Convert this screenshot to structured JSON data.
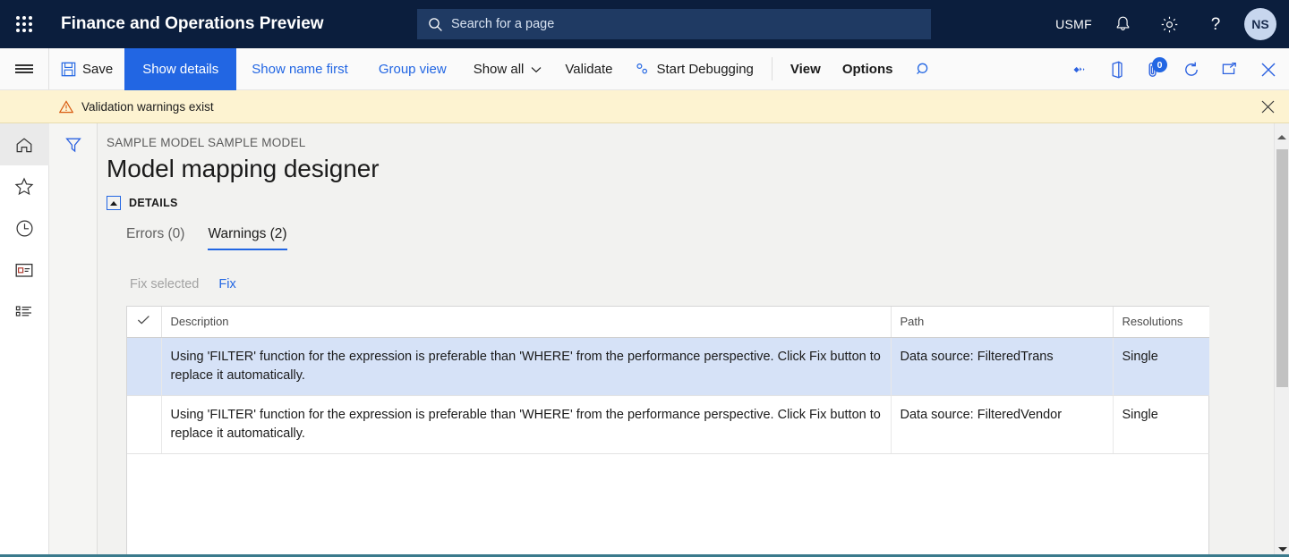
{
  "topbar": {
    "waffle_icon": "app-launcher-icon",
    "title": "Finance and Operations Preview",
    "search": {
      "placeholder": "Search for a page",
      "value": "",
      "icon": "search-icon"
    },
    "company": "USMF",
    "notifications_icon": "bell-icon",
    "settings_icon": "gear-icon",
    "help_icon": "question-mark-icon",
    "avatar_initials": "NS"
  },
  "commandbar": {
    "menu_icon": "hamburger-menu-icon",
    "save_label": "Save",
    "save_icon": "save-disk-icon",
    "show_details_label": "Show details",
    "show_name_first_label": "Show name first",
    "group_view_label": "Group view",
    "show_all_label": "Show all",
    "show_all_caret": "chevron-down-icon",
    "validate_label": "Validate",
    "start_debugging_label": "Start Debugging",
    "start_debugging_icon": "debug-gear-icon",
    "view_label": "View",
    "options_label": "Options",
    "search_icon": "search-icon",
    "right_icons": [
      {
        "name": "share-icon",
        "label": ""
      },
      {
        "name": "office-app-icon",
        "label": ""
      },
      {
        "name": "attachment-icon",
        "label": "",
        "badge": "0"
      },
      {
        "name": "refresh-icon",
        "label": ""
      },
      {
        "name": "popout-icon",
        "label": ""
      },
      {
        "name": "close-icon",
        "label": ""
      }
    ]
  },
  "messagebar": {
    "icon": "warning-triangle-icon",
    "text": "Validation warnings exist",
    "close_icon": "close-icon"
  },
  "rail": {
    "items": [
      {
        "name": "home-icon",
        "selected": true
      },
      {
        "name": "favorites-star-icon",
        "selected": false
      },
      {
        "name": "recent-clock-icon",
        "selected": false
      },
      {
        "name": "workspaces-icon",
        "selected": false
      },
      {
        "name": "modules-list-icon",
        "selected": false
      }
    ]
  },
  "filterpane": {
    "filter_icon": "filter-funnel-icon"
  },
  "page": {
    "breadcrumb": "SAMPLE MODEL SAMPLE MODEL",
    "title": "Model mapping designer",
    "details_section_label": "DETAILS",
    "details_collapse_icon": "collapse-caret-icon"
  },
  "tabs": [
    {
      "label": "Errors (0)",
      "selected": false
    },
    {
      "label": "Warnings (2)",
      "selected": true
    }
  ],
  "subactions": [
    {
      "label": "Fix selected",
      "disabled": true
    },
    {
      "label": "Fix",
      "disabled": false
    }
  ],
  "grid": {
    "select_all_icon": "checkmark-icon",
    "columns": [
      "Description",
      "Path",
      "Resolutions"
    ],
    "rows": [
      {
        "description": "Using 'FILTER' function for the expression is preferable than 'WHERE' from the performance perspective. Click Fix button to replace it automatically.",
        "path": "Data source: FilteredTrans",
        "resolutions": "Single",
        "selected": true
      },
      {
        "description": "Using 'FILTER' function for the expression is preferable than 'WHERE' from the performance perspective. Click Fix button to replace it automatically.",
        "path": "Data source: FilteredVendor",
        "resolutions": "Single",
        "selected": false
      }
    ]
  },
  "scrollbar": {
    "up_arrow_icon": "scroll-up-arrow-icon",
    "down_arrow_icon": "scroll-down-arrow-icon",
    "thumb": "scroll-thumb"
  },
  "colors": {
    "nav_bg": "#0b1e3d",
    "accent": "#2266e3",
    "warning_bg": "#fdf3d1",
    "row_selected": "#d6e2f7"
  }
}
